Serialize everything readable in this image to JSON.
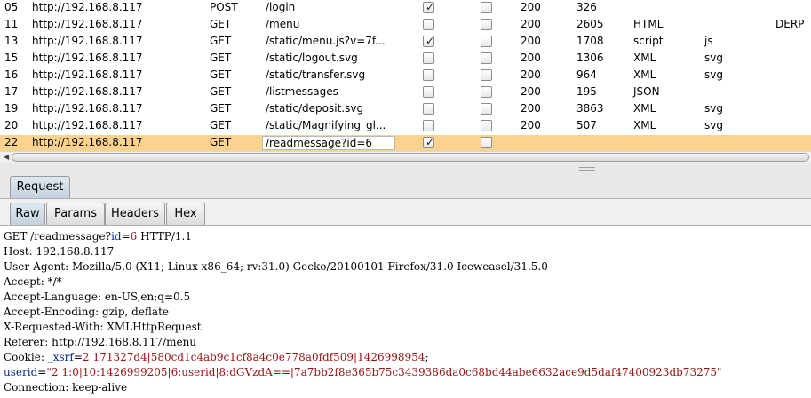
{
  "history": {
    "rows": [
      {
        "num": "05",
        "host": "http://192.168.8.117",
        "method": "POST",
        "url": "/login",
        "params": true,
        "edited": false,
        "status": "200",
        "length": "326",
        "mime": "",
        "ext": "",
        "title": ""
      },
      {
        "num": "11",
        "host": "http://192.168.8.117",
        "method": "GET",
        "url": "/menu",
        "params": false,
        "edited": false,
        "status": "200",
        "length": "2605",
        "mime": "HTML",
        "ext": "",
        "title": "DERP"
      },
      {
        "num": "13",
        "host": "http://192.168.8.117",
        "method": "GET",
        "url": "/static/menu.js?v=7f...",
        "params": true,
        "edited": false,
        "status": "200",
        "length": "1708",
        "mime": "script",
        "ext": "js",
        "title": ""
      },
      {
        "num": "15",
        "host": "http://192.168.8.117",
        "method": "GET",
        "url": "/static/logout.svg",
        "params": false,
        "edited": false,
        "status": "200",
        "length": "1306",
        "mime": "XML",
        "ext": "svg",
        "title": ""
      },
      {
        "num": "16",
        "host": "http://192.168.8.117",
        "method": "GET",
        "url": "/static/transfer.svg",
        "params": false,
        "edited": false,
        "status": "200",
        "length": "964",
        "mime": "XML",
        "ext": "svg",
        "title": ""
      },
      {
        "num": "17",
        "host": "http://192.168.8.117",
        "method": "GET",
        "url": "/listmessages",
        "params": false,
        "edited": false,
        "status": "200",
        "length": "195",
        "mime": "JSON",
        "ext": "",
        "title": ""
      },
      {
        "num": "19",
        "host": "http://192.168.8.117",
        "method": "GET",
        "url": "/static/deposit.svg",
        "params": false,
        "edited": false,
        "status": "200",
        "length": "3863",
        "mime": "XML",
        "ext": "svg",
        "title": ""
      },
      {
        "num": "20",
        "host": "http://192.168.8.117",
        "method": "GET",
        "url": "/static/Magnifying_gl...",
        "params": false,
        "edited": false,
        "status": "200",
        "length": "507",
        "mime": "XML",
        "ext": "svg",
        "title": ""
      },
      {
        "num": "22",
        "host": "http://192.168.8.117",
        "method": "GET",
        "url": "/readmessage?id=6",
        "params": true,
        "edited": false,
        "status": "",
        "length": "",
        "mime": "",
        "ext": "",
        "title": "",
        "selected": true
      }
    ]
  },
  "panel": {
    "request_tab": "Request"
  },
  "view_tabs": {
    "raw": "Raw",
    "params": "Params",
    "headers": "Headers",
    "hex": "Hex"
  },
  "message": {
    "request_line": {
      "pre": "GET /readmessage?",
      "name": "id",
      "eq": "=",
      "value": "6",
      "post": " HTTP/1.1"
    },
    "host": "Host: 192.168.8.117",
    "user_agent": "User-Agent: Mozilla/5.0 (X11; Linux x86_64; rv:31.0) Gecko/20100101 Firefox/31.0 Iceweasel/31.5.0",
    "accept": "Accept: */*",
    "accept_language": "Accept-Language: en-US,en;q=0.5",
    "accept_encoding": "Accept-Encoding: gzip, deflate",
    "x_requested_with": "X-Requested-With: XMLHttpRequest",
    "referer": "Referer: http://192.168.8.117/menu",
    "cookie": {
      "label": "Cookie: ",
      "name1": "_xsrf",
      "eq1": "=",
      "value1": "2|171327d4|580cd1c4ab9c1cf8a4c0e778a0fdf509|1426998954",
      "sep1": ";"
    },
    "cookie_cont": {
      "name2": "userid",
      "eq2": "=",
      "value2": "\"2|1:0|10:1426999205|6:userid|8:dGVzdA==|7a7bb2f8e365b75c3439386da0c68bd44abe6632ace9d5daf47400923db73275\""
    },
    "connection": "Connection: keep-alive"
  },
  "colors": {
    "selected_row": "#fcd38e",
    "param_name": "#0a2a8a",
    "param_value": "#9a1212"
  }
}
